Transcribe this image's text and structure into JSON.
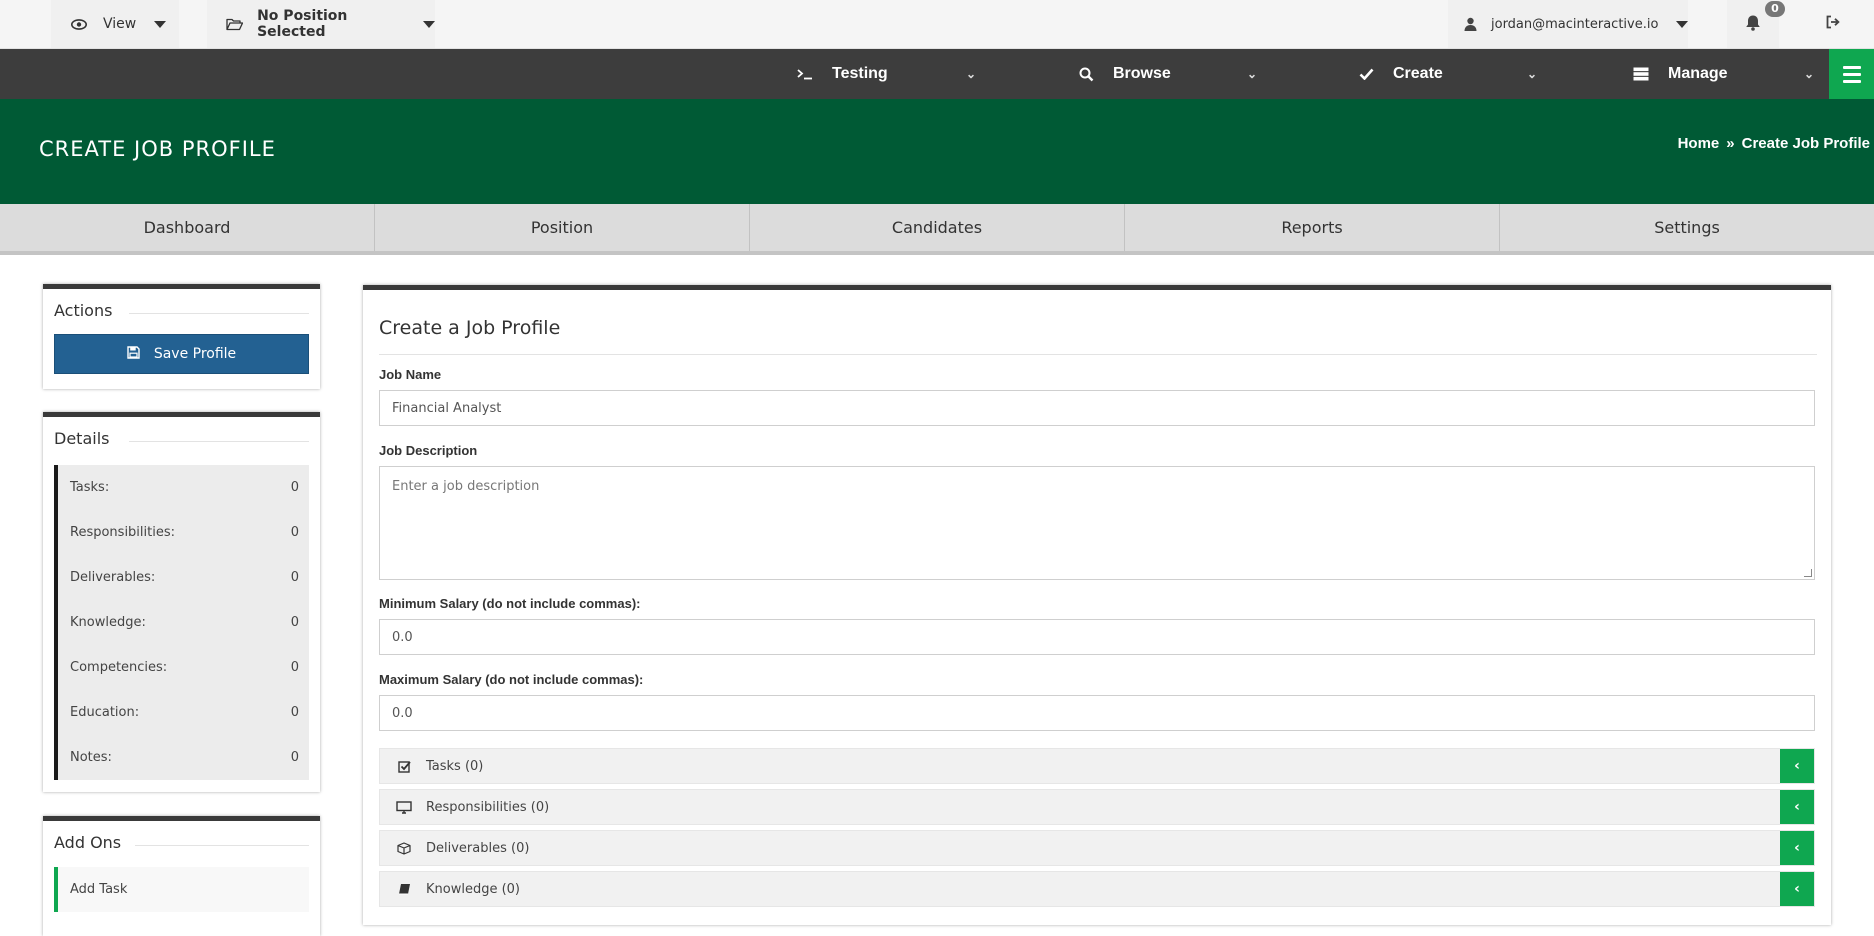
{
  "topbar": {
    "view_label": "View",
    "position_label": "No Position Selected",
    "user_email": "jordan@macinteractive.io",
    "notification_count": "0",
    "icons": {
      "view": "eye-icon",
      "position": "folder-open-icon",
      "user": "user-icon",
      "bell": "bell-icon",
      "exit": "sign-out-icon"
    }
  },
  "mainnav": {
    "items": [
      {
        "label": "Testing",
        "icon": "terminal-icon"
      },
      {
        "label": "Browse",
        "icon": "search-icon"
      },
      {
        "label": "Create",
        "icon": "check-icon"
      },
      {
        "label": "Manage",
        "icon": "server-icon"
      }
    ],
    "menu_icon": "hamburger-icon"
  },
  "header": {
    "title": "CREATE JOB PROFILE",
    "breadcrumb": {
      "home": "Home",
      "separator": "»",
      "current": "Create Job Profile"
    }
  },
  "tabs": [
    "Dashboard",
    "Position",
    "Candidates",
    "Reports",
    "Settings"
  ],
  "sidebar": {
    "actions": {
      "title": "Actions",
      "save_label": "Save Profile"
    },
    "details": {
      "title": "Details",
      "rows": [
        {
          "label": "Tasks:",
          "value": "0"
        },
        {
          "label": "Responsibilities:",
          "value": "0"
        },
        {
          "label": "Deliverables:",
          "value": "0"
        },
        {
          "label": "Knowledge:",
          "value": "0"
        },
        {
          "label": "Competencies:",
          "value": "0"
        },
        {
          "label": "Education:",
          "value": "0"
        },
        {
          "label": "Notes:",
          "value": "0"
        }
      ]
    },
    "addons": {
      "title": "Add Ons",
      "items": [
        "Add Task"
      ]
    }
  },
  "form": {
    "title": "Create a Job Profile",
    "job_name": {
      "label": "Job Name",
      "value": "Financial Analyst"
    },
    "job_description": {
      "label": "Job Description",
      "placeholder": "Enter a job description"
    },
    "min_salary": {
      "label": "Minimum Salary (do not include commas):",
      "value": "0.0"
    },
    "max_salary": {
      "label": "Maximum Salary (do not include commas):",
      "value": "0.0"
    },
    "sections": [
      {
        "label": "Tasks (0)",
        "icon": "check-square-icon"
      },
      {
        "label": "Responsibilities (0)",
        "icon": "desktop-icon"
      },
      {
        "label": "Deliverables (0)",
        "icon": "cube-icon"
      },
      {
        "label": "Knowledge (0)",
        "icon": "book-icon"
      }
    ]
  },
  "colors": {
    "brand_green": "#005a35",
    "accent_green": "#0fa750",
    "primary_button": "#236192",
    "nav_dark": "#3d3d3d"
  }
}
